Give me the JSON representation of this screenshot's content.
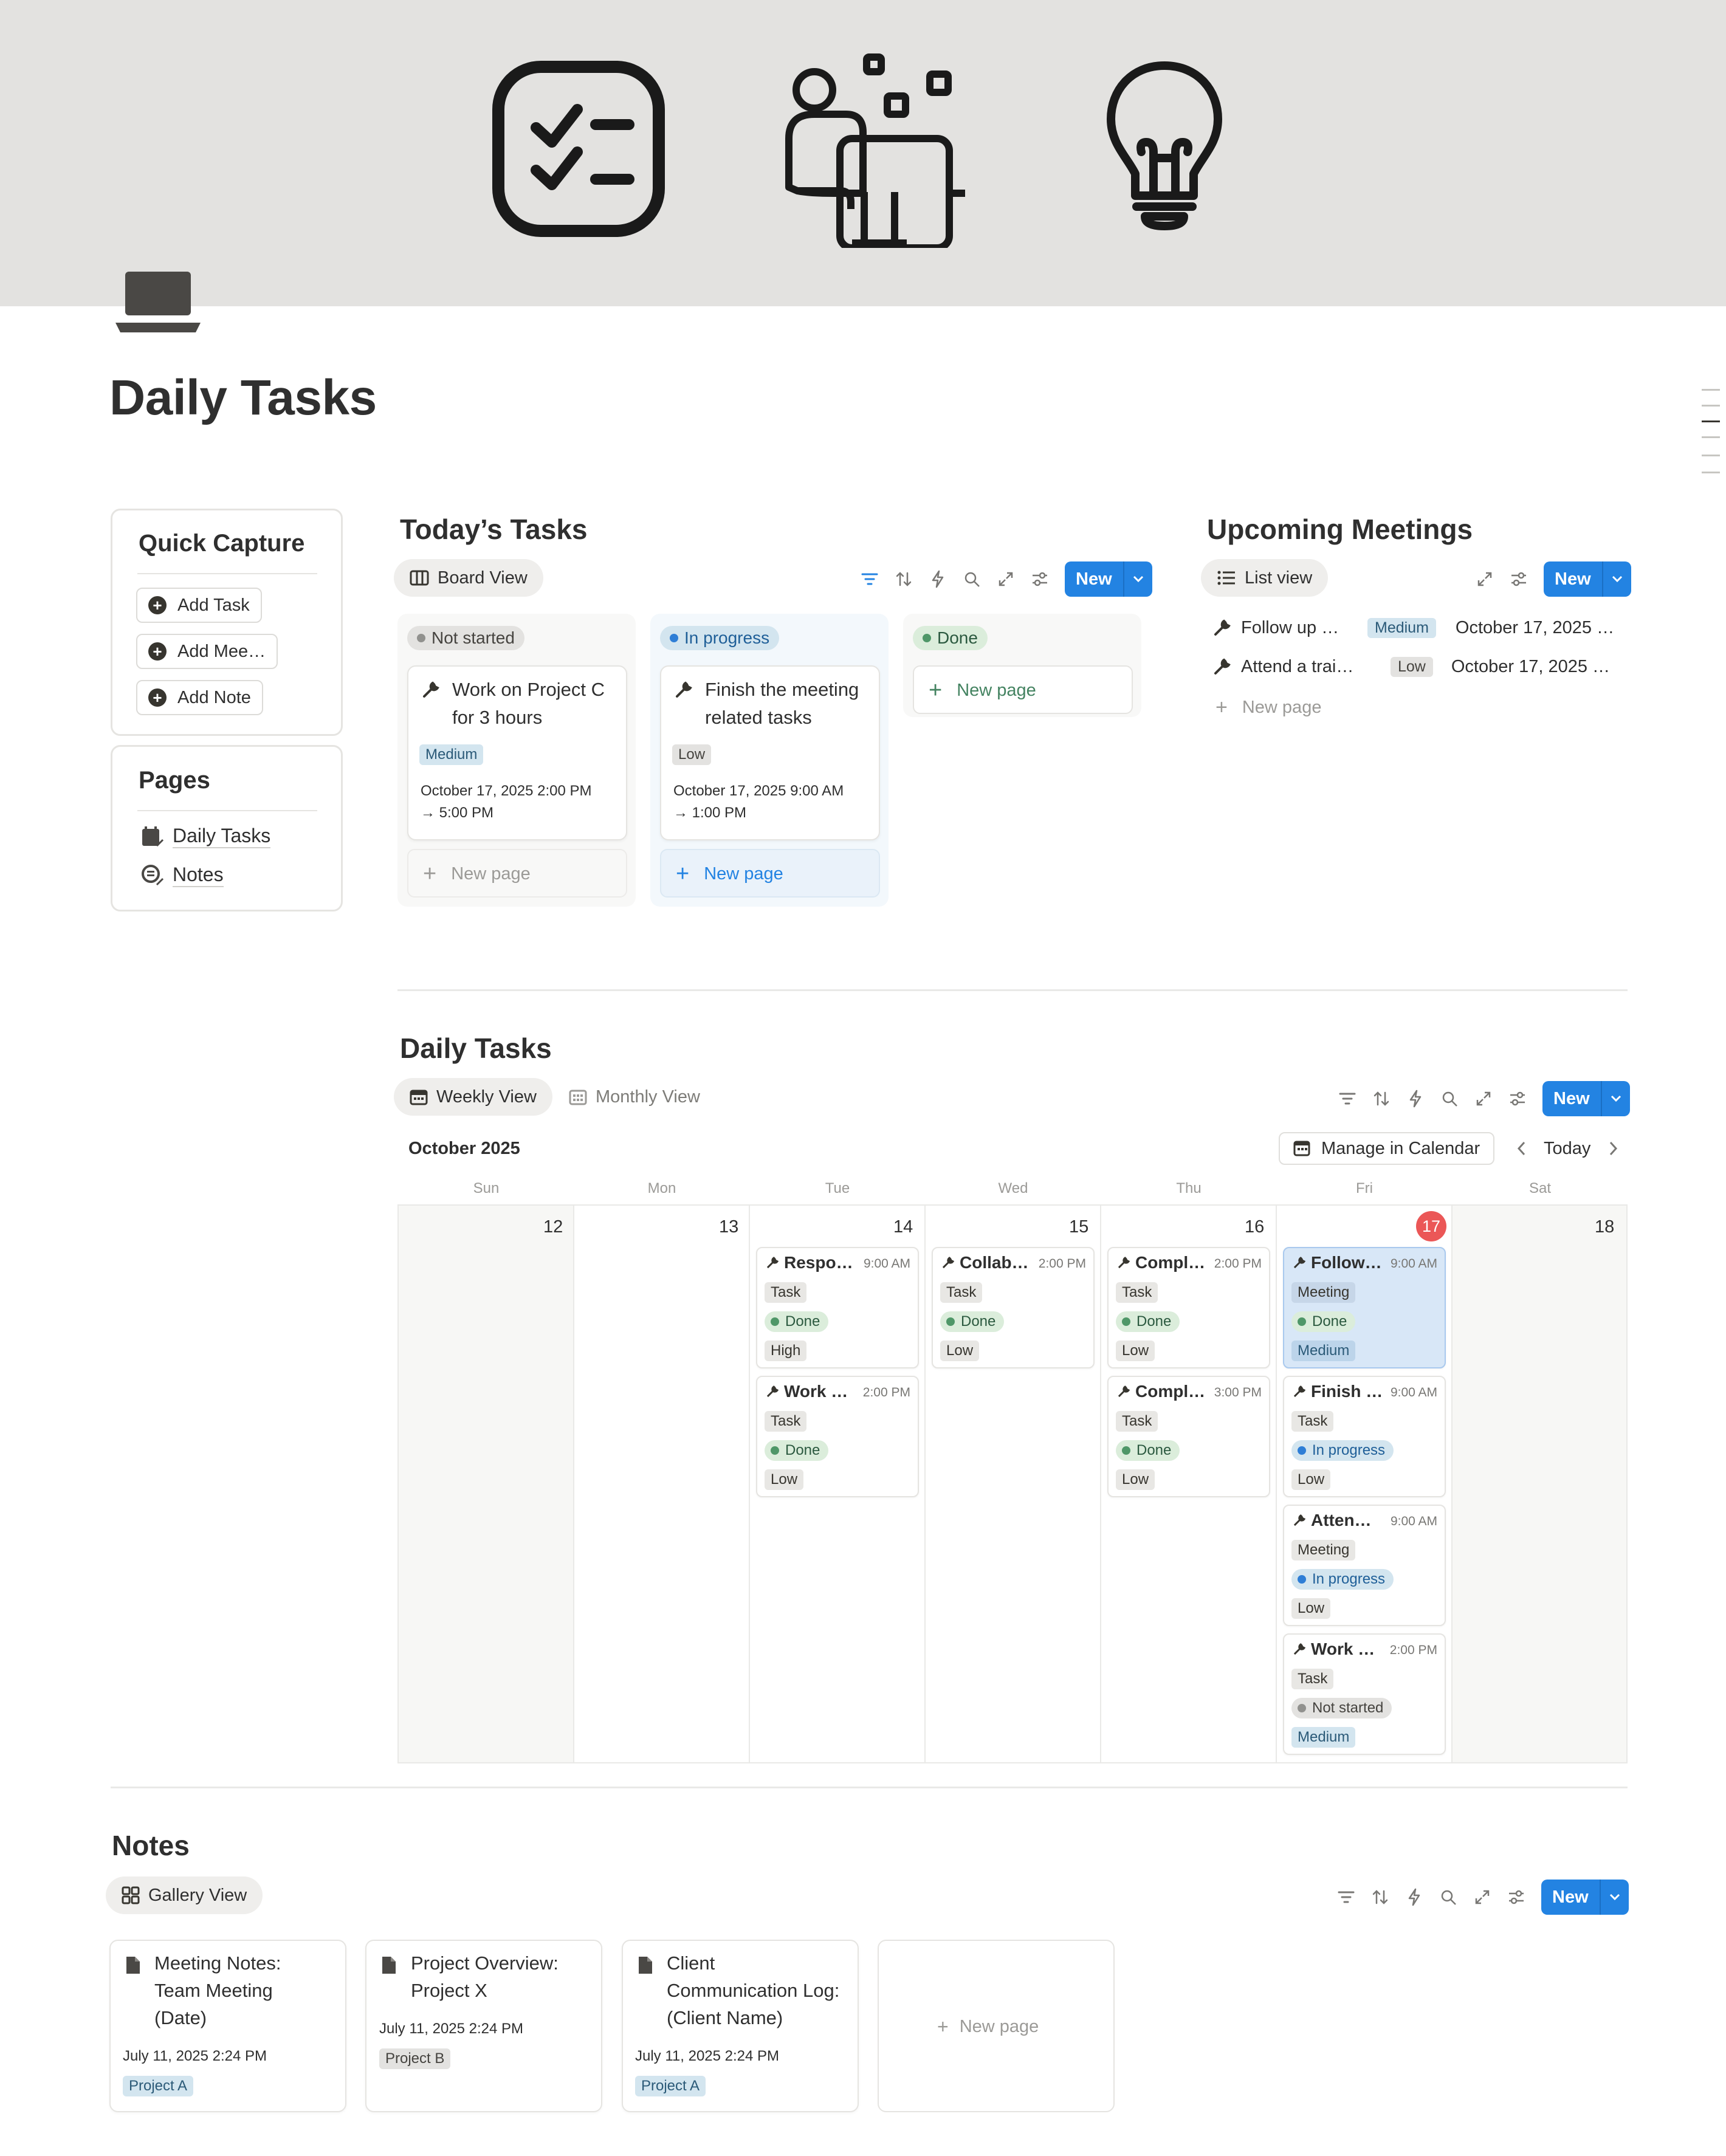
{
  "page": {
    "title": "Daily Tasks"
  },
  "quick_capture": {
    "title": "Quick Capture",
    "buttons": [
      "Add Task",
      "Add Mee…",
      "Add Note"
    ]
  },
  "pages_panel": {
    "title": "Pages",
    "links": [
      "Daily Tasks",
      "Notes"
    ]
  },
  "todays_tasks": {
    "title": "Today’s Tasks",
    "view_tab": "Board View",
    "new_label": "New",
    "columns": [
      {
        "status": "Not started",
        "card_title_1": "Work on Project C",
        "card_title_2": "for 3 hours",
        "priority": "Medium",
        "date_1": "October 17, 2025 2:00 PM",
        "date_2": "→ 5:00 PM",
        "new_page": "New page"
      },
      {
        "status": "In progress",
        "card_title_1": "Finish the meeting",
        "card_title_2": "related tasks",
        "priority": "Low",
        "date_1": "October 17, 2025 9:00 AM",
        "date_2": "→ 1:00 PM",
        "new_page": "New page"
      },
      {
        "status": "Done",
        "new_page": "New page"
      }
    ]
  },
  "upcoming_meetings": {
    "title": "Upcoming Meetings",
    "view_tab": "List view",
    "new_label": "New",
    "rows": [
      {
        "name": "Follow up …",
        "priority": "Medium",
        "date": "October 17, 2025 …"
      },
      {
        "name": "Attend a trai…",
        "priority": "Low",
        "date": "October 17, 2025 …"
      }
    ],
    "new_page": "New page"
  },
  "calendar": {
    "title": "Daily Tasks",
    "tabs": [
      "Weekly View",
      "Monthly View"
    ],
    "new_label": "New",
    "month": "October 2025",
    "manage_label": "Manage in Calendar",
    "today_label": "Today",
    "day_names": [
      "Sun",
      "Mon",
      "Tue",
      "Wed",
      "Thu",
      "Fri",
      "Sat"
    ],
    "days": [
      "12",
      "13",
      "14",
      "15",
      "16",
      "17",
      "18"
    ],
    "events": {
      "tue": [
        {
          "title": "Respo…",
          "time": "9:00 AM",
          "type": "Task",
          "status": "Done",
          "priority": "High"
        },
        {
          "title": "Work …",
          "time": "2:00 PM",
          "type": "Task",
          "status": "Done",
          "priority": "Low"
        }
      ],
      "wed": [
        {
          "title": "Collab…",
          "time": "2:00 PM",
          "type": "Task",
          "status": "Done",
          "priority": "Low"
        }
      ],
      "thu": [
        {
          "title": "Compl…",
          "time": "2:00 PM",
          "type": "Task",
          "status": "Done",
          "priority": "Low"
        },
        {
          "title": "Compl…",
          "time": "3:00 PM",
          "type": "Task",
          "status": "Done",
          "priority": "Low"
        }
      ],
      "fri": [
        {
          "title": "Follow…",
          "time": "9:00 AM",
          "type": "Meeting",
          "status": "Done",
          "priority": "Medium"
        },
        {
          "title": "Finish …",
          "time": "9:00 AM",
          "type": "Task",
          "status": "In progress",
          "priority": "Low"
        },
        {
          "title": "Atten…",
          "time": "9:00 AM",
          "type": "Meeting",
          "status": "In progress",
          "priority": "Low"
        },
        {
          "title": "Work …",
          "time": "2:00 PM",
          "type": "Task",
          "status": "Not started",
          "priority": "Medium"
        }
      ]
    }
  },
  "notes": {
    "title": "Notes",
    "view_tab": "Gallery View",
    "new_label": "New",
    "cards": [
      {
        "l1": "Meeting Notes:",
        "l2": "Team Meeting",
        "l3": "(Date)",
        "date": "July 11, 2025 2:24 PM",
        "project": "Project A"
      },
      {
        "l1": "Project Overview:",
        "l2": "Project X",
        "date": "July 11, 2025 2:24 PM",
        "project": "Project B"
      },
      {
        "l1": "Client",
        "l2": "Communication Log:",
        "l3": "(Client Name)",
        "date": "July 11, 2025 2:24 PM",
        "project": "Project A"
      }
    ],
    "new_page": "New page"
  },
  "colors": {
    "accent": "#2383e2",
    "cover": "#e3e2e0",
    "today": "#eb5757",
    "done_dot": "#4f9768",
    "progress_dot": "#2e7ed6"
  },
  "icons": [
    "checklist-icon",
    "person-at-desk-icon",
    "lightbulb-icon",
    "laptop-icon",
    "filter-icon",
    "sort-icon",
    "lightning-icon",
    "search-icon",
    "expand-icon",
    "settings-icon",
    "wrench-icon",
    "calendar-icon",
    "document-icon",
    "gallery-icon",
    "list-icon",
    "board-icon"
  ]
}
